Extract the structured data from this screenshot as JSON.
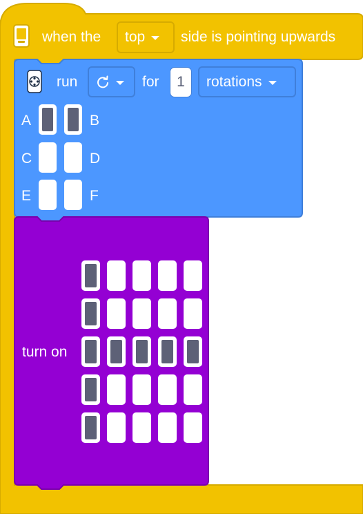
{
  "colors": {
    "event_yellow": "#f2c200",
    "motor_blue": "#4c97ff",
    "light_purple": "#9400d3",
    "pixel_on": "#5d6177",
    "pixel_off": "#ffffff"
  },
  "hat_block": {
    "icon": "hub-icon",
    "text_before": "when the",
    "side_value": "top",
    "text_after": "side is pointing upwards"
  },
  "motor_block": {
    "icon": "motor-icon",
    "run_label": "run",
    "direction_icon": "clockwise-icon",
    "for_label": "for",
    "amount_value": "1",
    "unit_value": "rotations",
    "ports": [
      {
        "label": "A",
        "on": true
      },
      {
        "label": "B",
        "on": true
      },
      {
        "label": "C",
        "on": false
      },
      {
        "label": "D",
        "on": false
      },
      {
        "label": "E",
        "on": false
      },
      {
        "label": "F",
        "on": false
      }
    ]
  },
  "light_block": {
    "label": "turn on",
    "matrix": [
      [
        1,
        0,
        0,
        0,
        0
      ],
      [
        1,
        0,
        0,
        0,
        0
      ],
      [
        1,
        1,
        1,
        1,
        1
      ],
      [
        1,
        0,
        0,
        0,
        0
      ],
      [
        1,
        0,
        0,
        0,
        0
      ]
    ]
  }
}
